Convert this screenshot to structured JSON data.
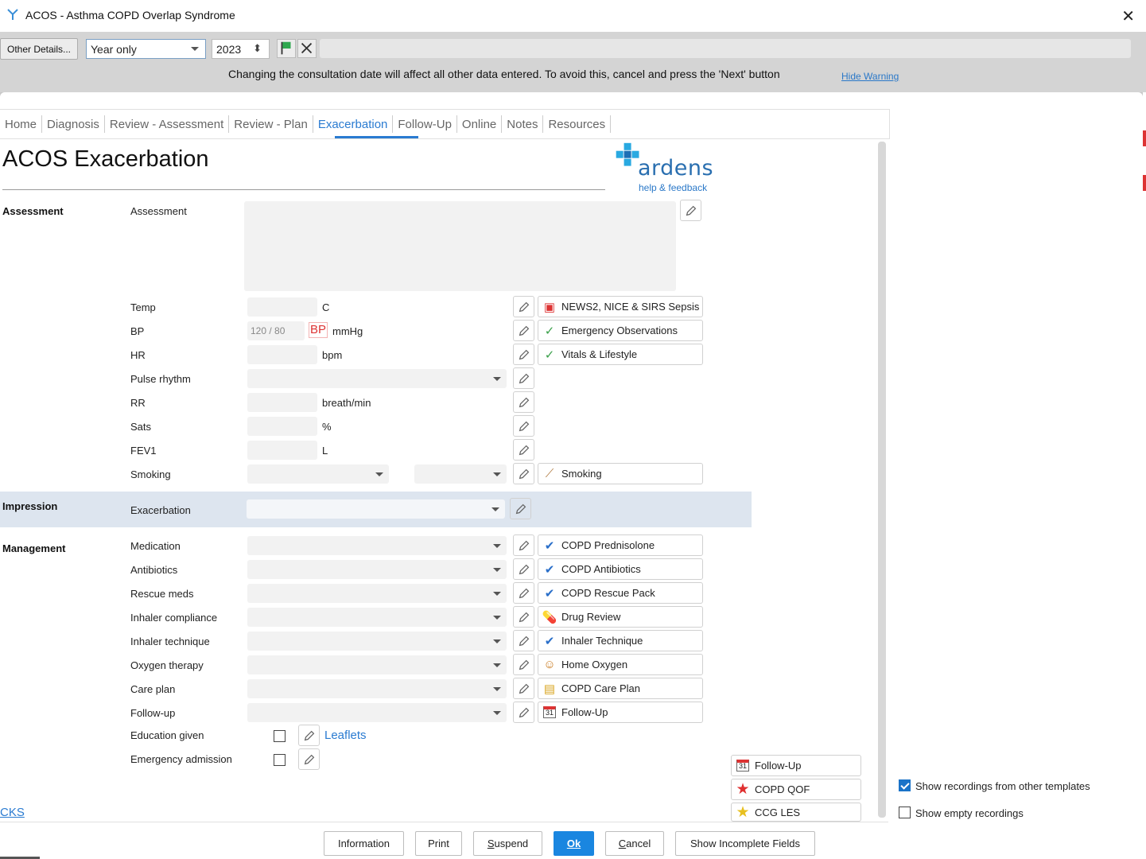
{
  "window": {
    "title": "ACOS - Asthma COPD Overlap Syndrome",
    "close_glyph": "✕"
  },
  "toolbar": {
    "other_details": "Other Details...",
    "date_mode": "Year only",
    "year": "2023",
    "year_spin": "⬍",
    "warning": "Changing the consultation date will affect all other data entered. To avoid this, cancel and press the 'Next' button",
    "hide_warning": "Hide Warning"
  },
  "tabs": [
    "Home",
    "Diagnosis",
    "Review - Assessment",
    "Review - Plan",
    "Exacerbation",
    "Follow-Up",
    "Online",
    "Notes",
    "Resources"
  ],
  "active_tab": "Exacerbation",
  "page_title": "ACOS Exacerbation",
  "brand": {
    "name": "ardens",
    "tagline": "help & feedback",
    "color": "#2a6fb0"
  },
  "sections": {
    "assessment": "Assessment",
    "impression": "Impression",
    "management": "Management"
  },
  "assessment": {
    "assessment_label": "Assessment",
    "temp": {
      "label": "Temp",
      "unit": "C"
    },
    "bp": {
      "label": "BP",
      "placeholder": "120 / 80",
      "badge": "BP",
      "unit": "mmHg"
    },
    "hr": {
      "label": "HR",
      "unit": "bpm"
    },
    "pulse_rhythm": {
      "label": "Pulse rhythm"
    },
    "rr": {
      "label": "RR",
      "unit": "breath/min"
    },
    "sats": {
      "label": "Sats",
      "unit": "%"
    },
    "fev1": {
      "label": "FEV1",
      "unit": "L"
    },
    "smoking": {
      "label": "Smoking"
    }
  },
  "assessment_links": {
    "news2": {
      "label": "NEWS2, NICE & SIRS Sepsis",
      "icon": "dice-icon"
    },
    "emergency_obs": {
      "label": "Emergency Observations",
      "icon": "check-icon"
    },
    "vitals": {
      "label": "Vitals & Lifestyle",
      "icon": "check-icon"
    },
    "smoking": {
      "label": "Smoking",
      "icon": "cigarette-icon"
    }
  },
  "impression": {
    "exacerbation_label": "Exacerbation"
  },
  "management": {
    "fields": [
      "Medication",
      "Antibiotics",
      "Rescue meds",
      "Inhaler compliance",
      "Inhaler technique",
      "Oxygen therapy",
      "Care plan",
      "Follow-up"
    ],
    "education_given": "Education given",
    "emergency_admission": "Emergency admission",
    "leaflets": "Leaflets"
  },
  "management_links": [
    "COPD Prednisolone",
    "COPD Antibiotics",
    "COPD Rescue Pack",
    "Drug Review",
    "Inhaler Technique",
    "Home Oxygen",
    "COPD Care Plan",
    "Follow-Up"
  ],
  "side_links": [
    "Follow-Up",
    "COPD QOF",
    "CCG LES"
  ],
  "calendar_day": "31",
  "options": {
    "show_other_templates": "Show recordings from other templates",
    "show_empty": "Show empty recordings"
  },
  "cks": "CKS",
  "footer": {
    "information": "Information",
    "print": "Print",
    "suspend_u": "S",
    "suspend_rest": "uspend",
    "ok": "Ok",
    "cancel_u": "C",
    "cancel_rest": "ancel",
    "show_incomplete": "Show Incomplete Fields"
  },
  "colors": {
    "accent": "#2a7bd1",
    "impression_band": "#dde5ef",
    "ok_button": "#1a86e0"
  }
}
